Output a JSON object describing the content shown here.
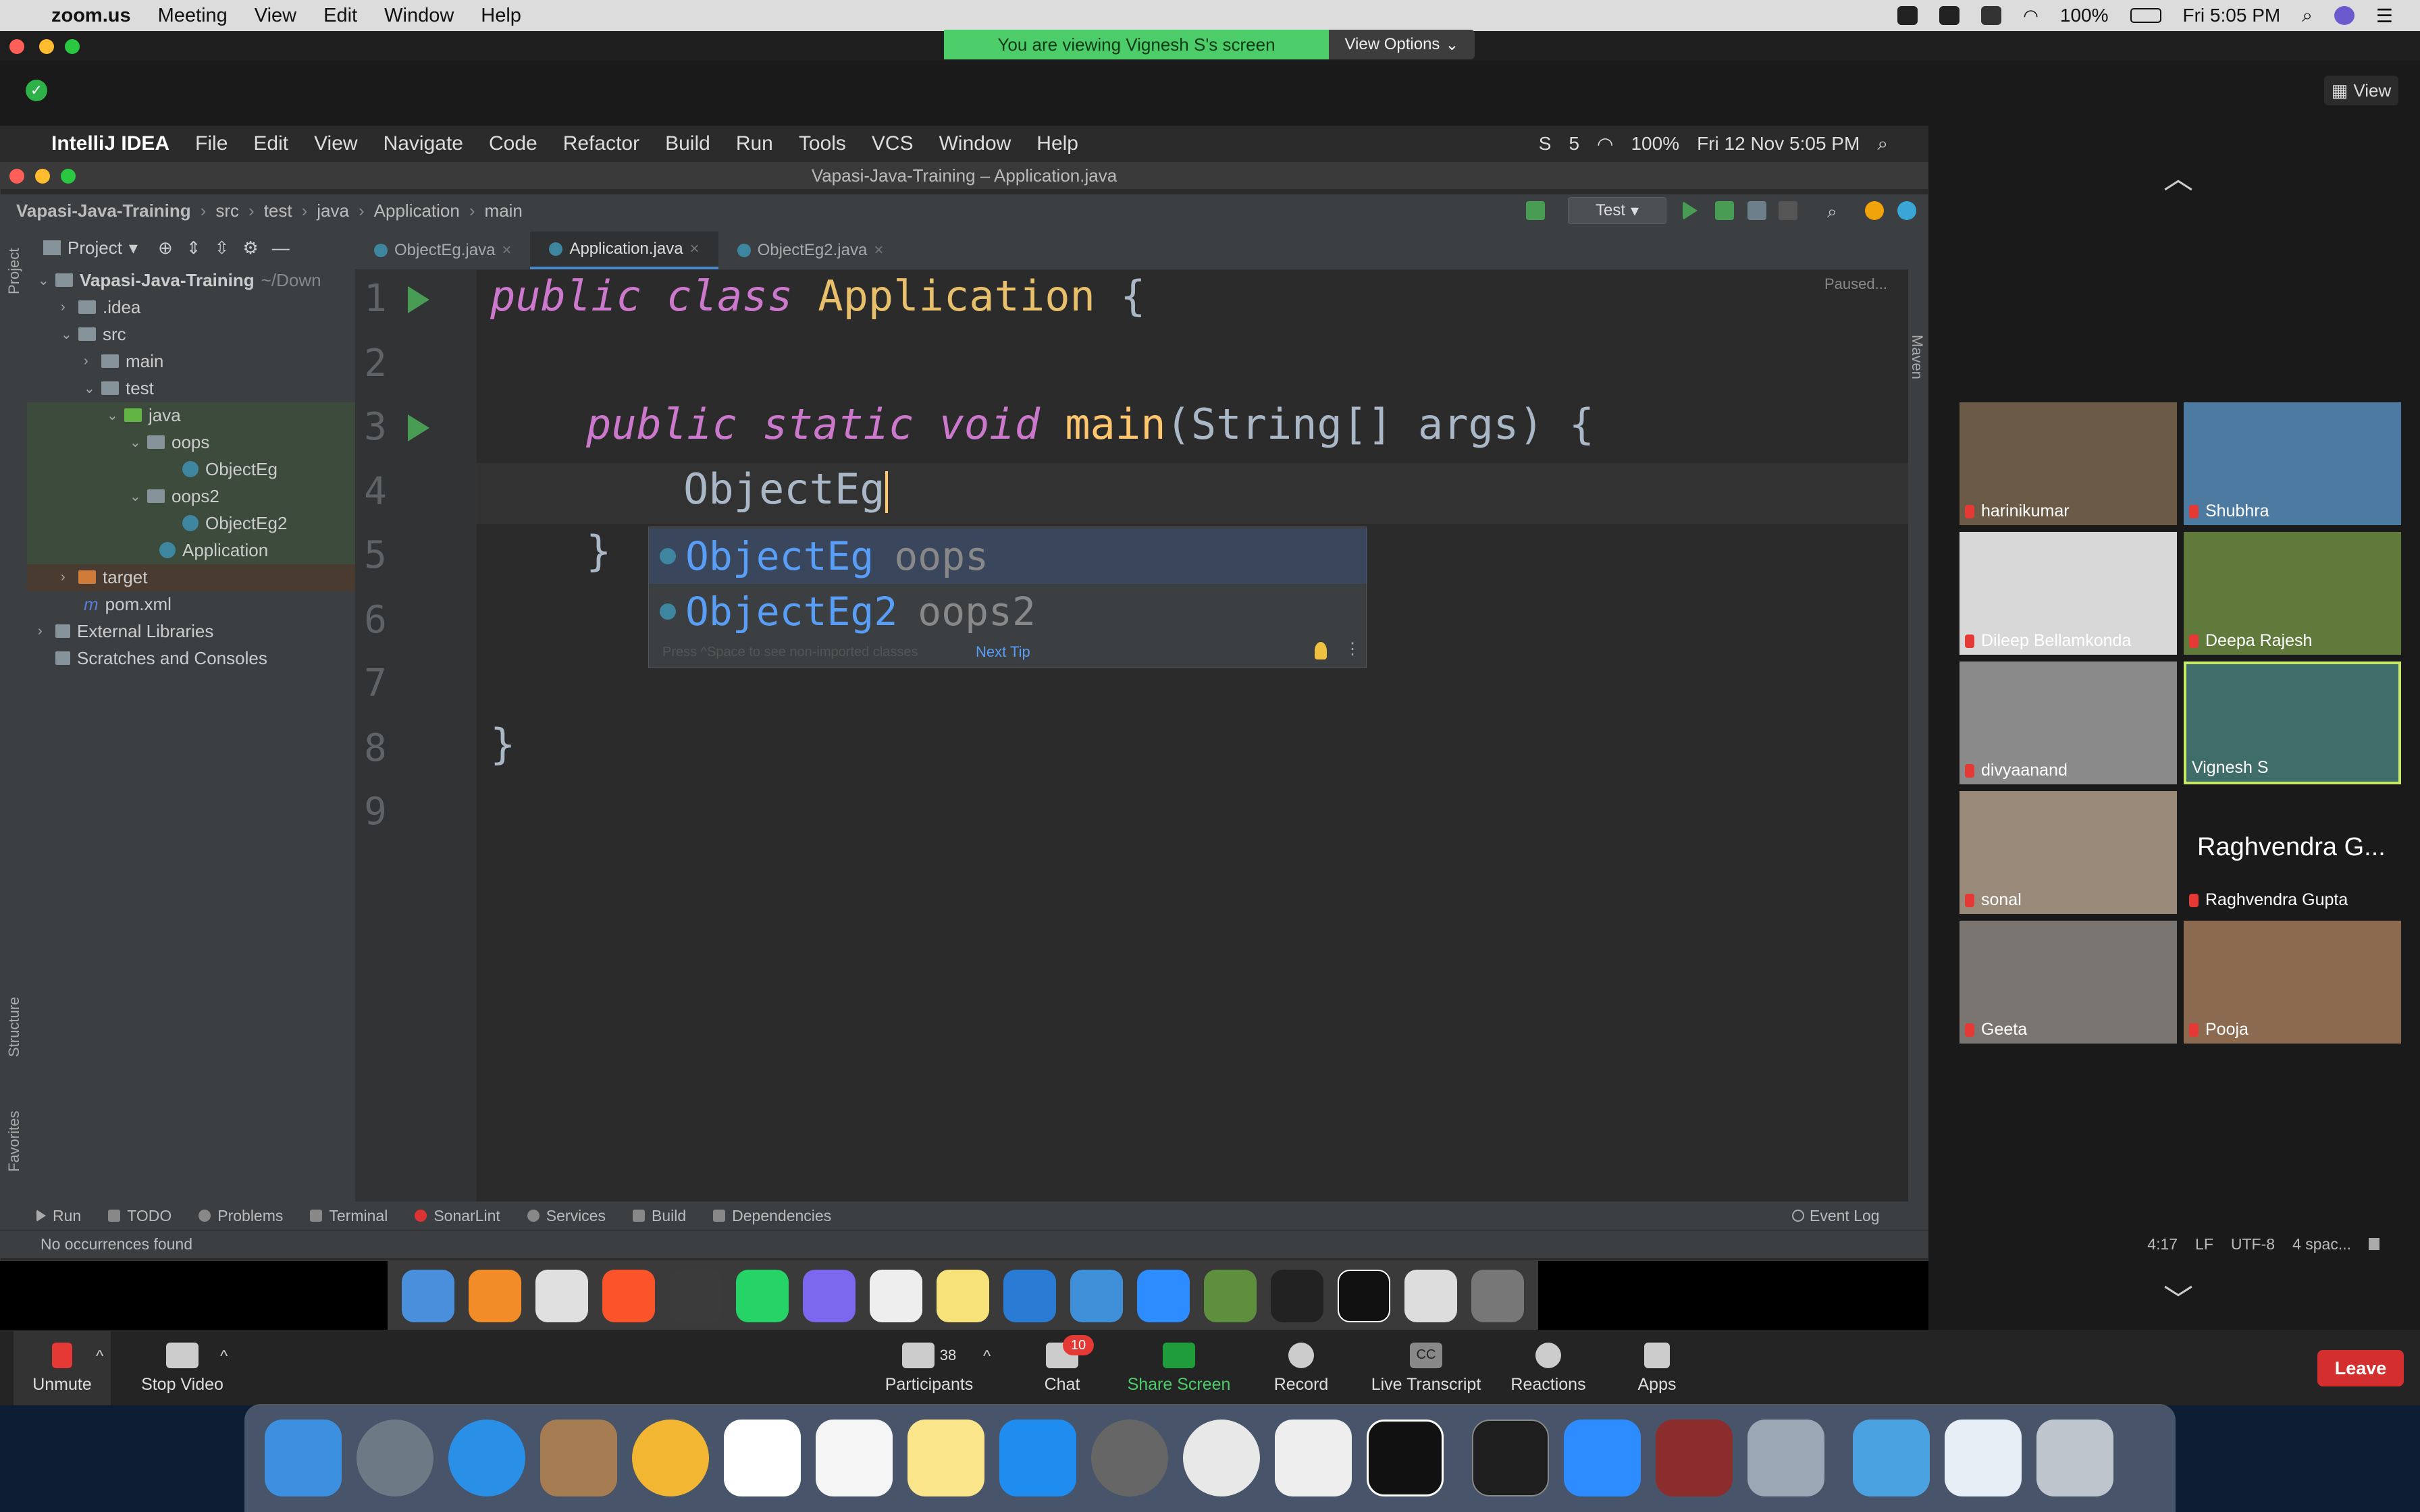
{
  "mac_menubar": {
    "app": "zoom.us",
    "items": [
      "Meeting",
      "View",
      "Edit",
      "Window",
      "Help"
    ],
    "battery": "100%",
    "clock": "Fri 5:05 PM"
  },
  "zoom": {
    "share_banner": "You are viewing Vignesh S's screen",
    "view_options": "View Options",
    "view_button": "View",
    "toolbar": {
      "unmute": "Unmute",
      "stop_video": "Stop Video",
      "participants": "Participants",
      "participants_count": "38",
      "chat": "Chat",
      "chat_badge": "10",
      "share_screen": "Share Screen",
      "record": "Record",
      "live_transcript": "Live Transcript",
      "cc": "CC",
      "reactions": "Reactions",
      "apps": "Apps",
      "leave": "Leave"
    },
    "participants": [
      {
        "name": "harinikumar"
      },
      {
        "name": "Shubhra"
      },
      {
        "name": "Dileep Bellamkonda"
      },
      {
        "name": "Deepa Rajesh"
      },
      {
        "name": "divyaanand"
      },
      {
        "name": "Vignesh S"
      },
      {
        "name": "sonal"
      },
      {
        "name": "Raghvendra Gupta",
        "display": "Raghvendra G..."
      },
      {
        "name": "Geeta"
      },
      {
        "name": "Pooja"
      }
    ]
  },
  "shared_screen": {
    "ij_menubar": {
      "app": "IntelliJ IDEA",
      "items": [
        "File",
        "Edit",
        "View",
        "Navigate",
        "Code",
        "Refactor",
        "Build",
        "Run",
        "Tools",
        "VCS",
        "Window",
        "Help"
      ],
      "battery": "100%",
      "clock": "Fri 12 Nov  5:05 PM"
    },
    "window_title": "Vapasi-Java-Training – Application.java",
    "breadcrumbs": [
      "Vapasi-Java-Training",
      "src",
      "test",
      "java",
      "Application",
      "main"
    ],
    "run_config": "Test",
    "project_panel": {
      "title": "Project",
      "tree": [
        {
          "label": "Vapasi-Java-Training",
          "suffix": "~/Down"
        },
        {
          "label": ".idea"
        },
        {
          "label": "src"
        },
        {
          "label": "main"
        },
        {
          "label": "test"
        },
        {
          "label": "java"
        },
        {
          "label": "oops"
        },
        {
          "label": "ObjectEg"
        },
        {
          "label": "oops2"
        },
        {
          "label": "ObjectEg2"
        },
        {
          "label": "Application"
        },
        {
          "label": "target"
        },
        {
          "label": "pom.xml"
        },
        {
          "label": "External Libraries"
        },
        {
          "label": "Scratches and Consoles"
        }
      ]
    },
    "tabs": [
      "ObjectEg.java",
      "Application.java",
      "ObjectEg2.java"
    ],
    "active_tab": "Application.java",
    "paused": "Paused...",
    "line_numbers": [
      "1",
      "2",
      "3",
      "4",
      "5",
      "6",
      "7",
      "8",
      "9"
    ],
    "code": {
      "l1_kw1": "public",
      "l1_kw2": "class",
      "l1_name": "Application",
      "l1_brace": "{",
      "l3_kw1": "public",
      "l3_kw2": "static",
      "l3_kw3": "void",
      "l3_fn": "main",
      "l3_rest": "(String[] args) {",
      "l3_params": "args",
      "l4": "ObjectEg",
      "l5": "}",
      "l8": "}"
    },
    "completion": {
      "items": [
        {
          "name": "ObjectEg",
          "pkg": "oops"
        },
        {
          "name": "ObjectEg2",
          "pkg": "oops2"
        }
      ],
      "hint": "Press ^Space to see non-imported classes",
      "next_tip": "Next Tip"
    },
    "side_labels": {
      "project": "Project",
      "structure": "Structure",
      "favorites": "Favorites",
      "maven": "Maven"
    },
    "bottom_tools": [
      "Run",
      "TODO",
      "Problems",
      "Terminal",
      "SonarLint",
      "Services",
      "Build",
      "Dependencies"
    ],
    "event_log": "Event Log",
    "status_left": "No occurrences found",
    "status_right": [
      "4:17",
      "LF",
      "UTF-8",
      "4 spac..."
    ]
  }
}
